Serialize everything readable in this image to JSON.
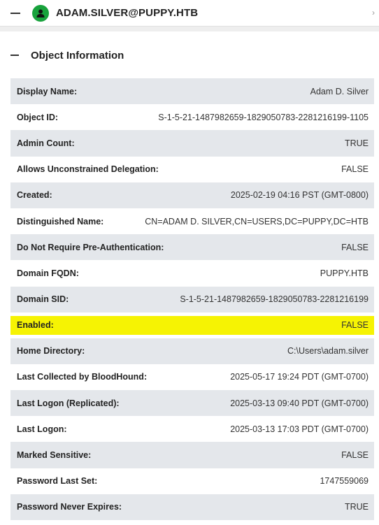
{
  "node": {
    "name": "ADAM.SILVER@PUPPY.HTB",
    "icon": "user-icon",
    "icon_color": "#18a23c"
  },
  "section": {
    "title": "Object Information"
  },
  "highlight_color": "#f6f303",
  "rows": [
    {
      "label": "Display Name:",
      "value": "Adam D. Silver"
    },
    {
      "label": "Object ID:",
      "value": "S-1-5-21-1487982659-1829050783-2281216199-1105"
    },
    {
      "label": "Admin Count:",
      "value": "TRUE"
    },
    {
      "label": "Allows Unconstrained Delegation:",
      "value": "FALSE"
    },
    {
      "label": "Created:",
      "value": "2025-02-19 04:16 PST (GMT-0800)"
    },
    {
      "label": "Distinguished Name:",
      "value": "CN=ADAM D. SILVER,CN=USERS,DC=PUPPY,DC=HTB"
    },
    {
      "label": "Do Not Require Pre-Authentication:",
      "value": "FALSE"
    },
    {
      "label": "Domain FQDN:",
      "value": "PUPPY.HTB"
    },
    {
      "label": "Domain SID:",
      "value": "S-1-5-21-1487982659-1829050783-2281216199"
    },
    {
      "label": "Enabled:",
      "value": "FALSE",
      "highlighted": true
    },
    {
      "label": "Home Directory:",
      "value": "C:\\Users\\adam.silver"
    },
    {
      "label": "Last Collected by BloodHound:",
      "value": "2025-05-17 19:24 PDT (GMT-0700)"
    },
    {
      "label": "Last Logon (Replicated):",
      "value": "2025-03-13 09:40 PDT (GMT-0700)"
    },
    {
      "label": "Last Logon:",
      "value": "2025-03-13 17:03 PDT (GMT-0700)"
    },
    {
      "label": "Marked Sensitive:",
      "value": "FALSE"
    },
    {
      "label": "Password Last Set:",
      "value": "1747559069"
    },
    {
      "label": "Password Never Expires:",
      "value": "TRUE"
    }
  ]
}
